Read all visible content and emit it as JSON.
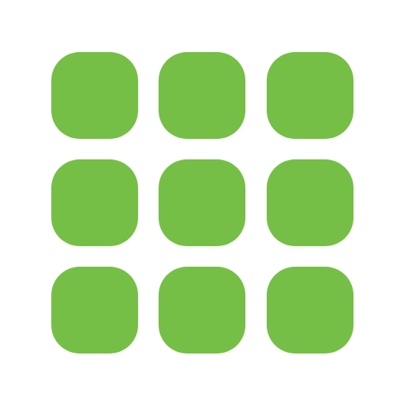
{
  "icon": {
    "semantic": "app-grid-icon",
    "color": "#76BF46",
    "background": "#FFFFFF",
    "rows": 3,
    "columns": 3,
    "tiles": [
      {
        "id": "tile-1"
      },
      {
        "id": "tile-2"
      },
      {
        "id": "tile-3"
      },
      {
        "id": "tile-4"
      },
      {
        "id": "tile-5"
      },
      {
        "id": "tile-6"
      },
      {
        "id": "tile-7"
      },
      {
        "id": "tile-8"
      },
      {
        "id": "tile-9"
      }
    ]
  }
}
